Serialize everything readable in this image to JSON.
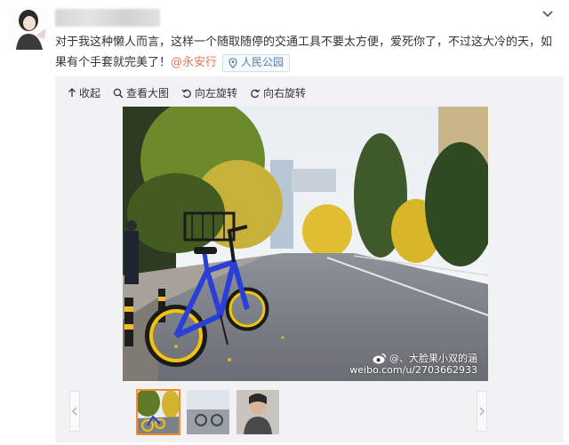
{
  "post": {
    "text": "对于我这种懒人而言，这样一个随取随停的交通工具不要太方便，爱死你了，不过这大冷的天，如果有个手套就完美了！",
    "mention": "@永安行",
    "location": "人民公园"
  },
  "toolbar": {
    "collapse": "收起",
    "view_large": "查看大图",
    "rotate_left": "向左旋转",
    "rotate_right": "向右旋转"
  },
  "watermark": {
    "line1": "@、大脸果小双的涵",
    "line2": "weibo.com/u/2703662933"
  },
  "thumbnails": [
    {
      "label": "photo-1",
      "selected": true
    },
    {
      "label": "photo-2",
      "selected": false
    },
    {
      "label": "photo-3",
      "selected": false
    }
  ],
  "colors": {
    "mention": "#eb7350",
    "location": "#4f7fa8",
    "selected_thumb": "#ff8a2a",
    "bike_frame": "#2a3fd6",
    "bike_wheel": "#f2c40f"
  }
}
